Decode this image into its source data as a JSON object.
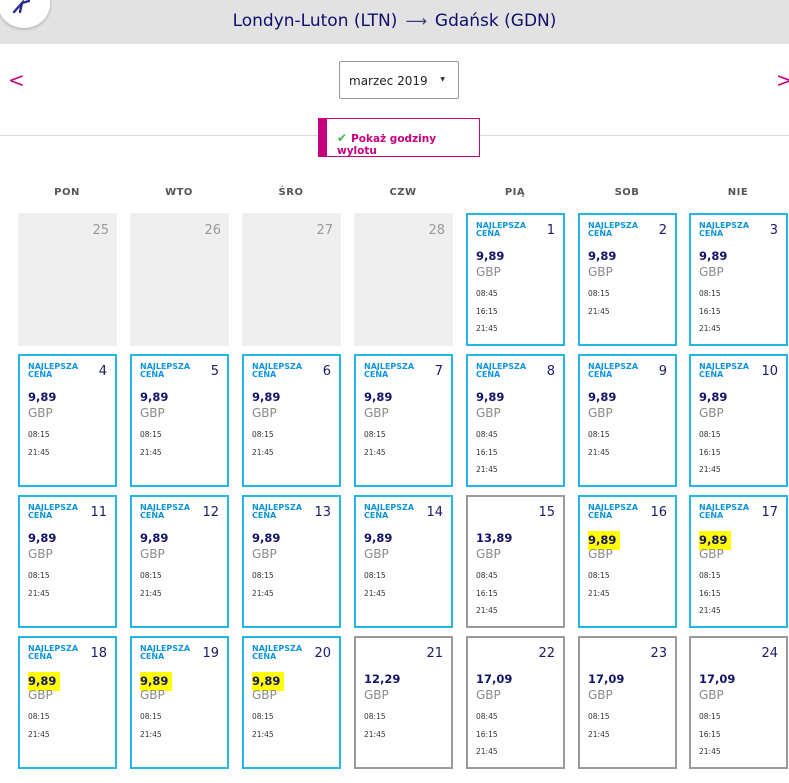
{
  "header": {
    "origin": "Londyn-Luton (LTN)",
    "arrow": "⟶",
    "destination": "Gdańsk (GDN)"
  },
  "nav": {
    "prev": "<",
    "next": ">"
  },
  "month_select": {
    "value": "marzec 2019",
    "caret": "▼"
  },
  "toggle": {
    "check": "✔",
    "label": "Pokaż godziny wylotu"
  },
  "weekdays": [
    "PON",
    "WTO",
    "ŚRO",
    "CZW",
    "PIĄ",
    "SOB",
    "NIE"
  ],
  "calendar": {
    "badge_line1": "NAJLEPSZA",
    "badge_line2": "CENA",
    "currency": "GBP",
    "rows": [
      [
        {
          "day": "25",
          "empty": true
        },
        {
          "day": "26",
          "empty": true
        },
        {
          "day": "27",
          "empty": true
        },
        {
          "day": "28",
          "empty": true
        },
        {
          "day": "1",
          "best": true,
          "price": "9,89",
          "highlight": false,
          "times": [
            "08:45",
            "16:15",
            "21:45"
          ]
        },
        {
          "day": "2",
          "best": true,
          "price": "9,89",
          "highlight": false,
          "times": [
            "08:15",
            "21:45"
          ]
        },
        {
          "day": "3",
          "best": true,
          "price": "9,89",
          "highlight": false,
          "times": [
            "08:15",
            "16:15",
            "21:45"
          ]
        }
      ],
      [
        {
          "day": "4",
          "best": true,
          "price": "9,89",
          "highlight": false,
          "times": [
            "08:15",
            "21:45"
          ]
        },
        {
          "day": "5",
          "best": true,
          "price": "9,89",
          "highlight": false,
          "times": [
            "08:15",
            "21:45"
          ]
        },
        {
          "day": "6",
          "best": true,
          "price": "9,89",
          "highlight": false,
          "times": [
            "08:15",
            "21:45"
          ]
        },
        {
          "day": "7",
          "best": true,
          "price": "9,89",
          "highlight": false,
          "times": [
            "08:15",
            "21:45"
          ]
        },
        {
          "day": "8",
          "best": true,
          "price": "9,89",
          "highlight": false,
          "times": [
            "08:45",
            "16:15",
            "21:45"
          ]
        },
        {
          "day": "9",
          "best": true,
          "price": "9,89",
          "highlight": false,
          "times": [
            "08:15",
            "21:45"
          ]
        },
        {
          "day": "10",
          "best": true,
          "price": "9,89",
          "highlight": false,
          "times": [
            "08:15",
            "16:15",
            "21:45"
          ]
        }
      ],
      [
        {
          "day": "11",
          "best": true,
          "price": "9,89",
          "highlight": false,
          "times": [
            "08:15",
            "21:45"
          ]
        },
        {
          "day": "12",
          "best": true,
          "price": "9,89",
          "highlight": false,
          "times": [
            "08:15",
            "21:45"
          ]
        },
        {
          "day": "13",
          "best": true,
          "price": "9,89",
          "highlight": false,
          "times": [
            "08:15",
            "21:45"
          ]
        },
        {
          "day": "14",
          "best": true,
          "price": "9,89",
          "highlight": false,
          "times": [
            "08:15",
            "21:45"
          ]
        },
        {
          "day": "15",
          "best": false,
          "price": "13,89",
          "highlight": false,
          "times": [
            "08:45",
            "16:15",
            "21:45"
          ]
        },
        {
          "day": "16",
          "best": true,
          "price": "9,89",
          "highlight": true,
          "times": [
            "08:15",
            "21:45"
          ]
        },
        {
          "day": "17",
          "best": true,
          "price": "9,89",
          "highlight": true,
          "times": [
            "08:15",
            "16:15",
            "21:45"
          ]
        }
      ],
      [
        {
          "day": "18",
          "best": true,
          "price": "9,89",
          "highlight": true,
          "times": [
            "08:15",
            "21:45"
          ]
        },
        {
          "day": "19",
          "best": true,
          "price": "9,89",
          "highlight": true,
          "times": [
            "08:15",
            "21:45"
          ]
        },
        {
          "day": "20",
          "best": true,
          "price": "9,89",
          "highlight": true,
          "times": [
            "08:15",
            "21:45"
          ]
        },
        {
          "day": "21",
          "best": false,
          "price": "12,29",
          "highlight": false,
          "times": [
            "08:15",
            "21:45"
          ]
        },
        {
          "day": "22",
          "best": false,
          "price": "17,09",
          "highlight": false,
          "times": [
            "08:45",
            "16:15",
            "21:45"
          ]
        },
        {
          "day": "23",
          "best": false,
          "price": "17,09",
          "highlight": false,
          "times": [
            "08:15",
            "21:45"
          ]
        },
        {
          "day": "24",
          "best": false,
          "price": "17,09",
          "highlight": false,
          "times": [
            "08:15",
            "16:15",
            "21:45"
          ]
        }
      ]
    ]
  },
  "colors": {
    "accent": "#c6007e",
    "best_border": "#23b6e6",
    "regular_border": "#9a9a9a",
    "highlight": "#ffff00",
    "price_text": "#13136a"
  }
}
